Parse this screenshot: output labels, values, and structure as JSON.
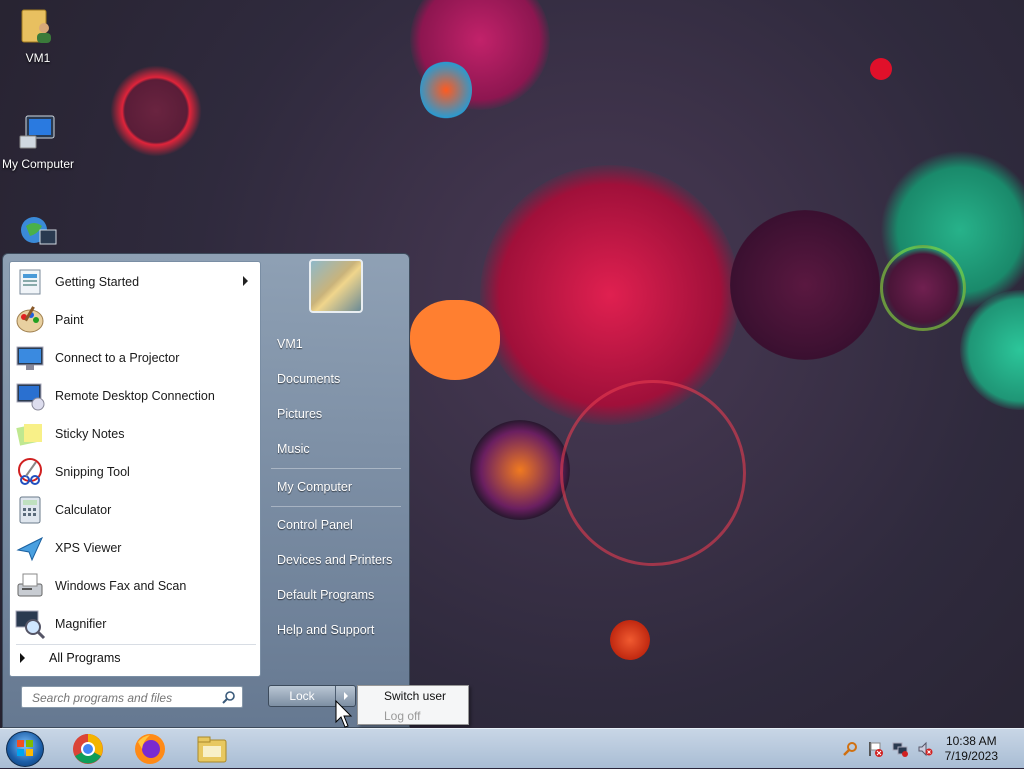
{
  "desktop": {
    "icons": [
      {
        "label": "VM1",
        "icon": "user-folder-icon"
      },
      {
        "label": "My Computer",
        "icon": "computer-icon"
      },
      {
        "label": "",
        "icon": "network-globe-icon"
      }
    ]
  },
  "start_menu": {
    "programs": [
      {
        "label": "Getting Started",
        "icon": "getting-started-icon",
        "has_submenu": true
      },
      {
        "label": "Paint",
        "icon": "paint-icon"
      },
      {
        "label": "Connect to a Projector",
        "icon": "projector-icon"
      },
      {
        "label": "Remote Desktop Connection",
        "icon": "remote-desktop-icon"
      },
      {
        "label": "Sticky Notes",
        "icon": "sticky-notes-icon"
      },
      {
        "label": "Snipping Tool",
        "icon": "snipping-tool-icon"
      },
      {
        "label": "Calculator",
        "icon": "calculator-icon"
      },
      {
        "label": "XPS Viewer",
        "icon": "xps-viewer-icon"
      },
      {
        "label": "Windows Fax and Scan",
        "icon": "fax-scan-icon"
      },
      {
        "label": "Magnifier",
        "icon": "magnifier-icon"
      }
    ],
    "all_programs_label": "All Programs",
    "search_placeholder": "Search programs and files",
    "right_items": {
      "user": "VM1",
      "documents": "Documents",
      "pictures": "Pictures",
      "music": "Music",
      "computer": "My Computer",
      "control_panel": "Control Panel",
      "devices": "Devices and Printers",
      "default_programs": "Default Programs",
      "help": "Help and Support"
    },
    "lock_label": "Lock",
    "submenu": {
      "switch_user": "Switch user",
      "log_off": "Log off"
    }
  },
  "taskbar": {
    "apps": [
      "chrome-icon",
      "firefox-icon",
      "file-explorer-icon"
    ],
    "time": "10:38 AM",
    "date": "7/19/2023"
  }
}
